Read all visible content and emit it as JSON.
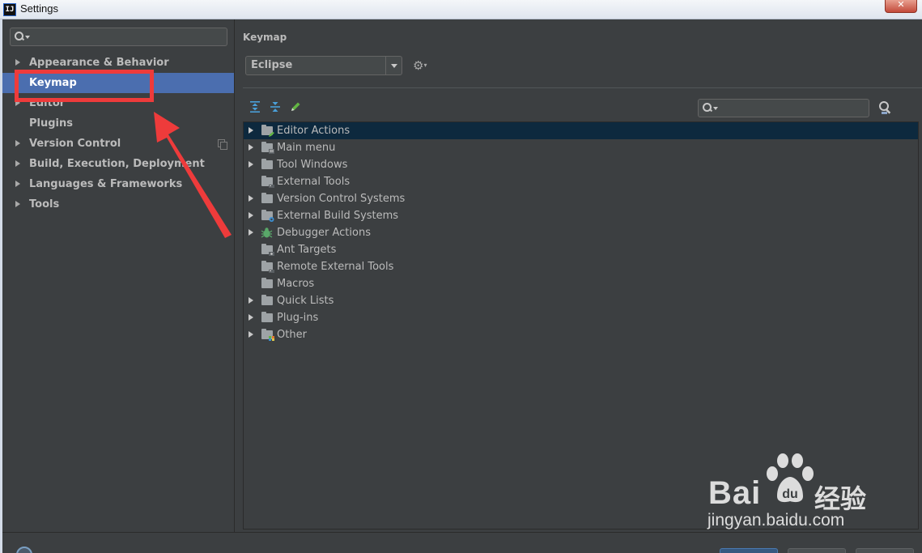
{
  "window": {
    "title": "Settings",
    "app_icon_text": "IJ"
  },
  "sidebar": {
    "search": {
      "value": ""
    },
    "items": [
      {
        "label": "Appearance & Behavior",
        "expandable": true
      },
      {
        "label": "Keymap",
        "expandable": false,
        "selected": true
      },
      {
        "label": "Editor",
        "expandable": true
      },
      {
        "label": "Plugins",
        "expandable": false
      },
      {
        "label": "Version Control",
        "expandable": true
      },
      {
        "label": "Build, Execution, Deployment",
        "expandable": true
      },
      {
        "label": "Languages & Frameworks",
        "expandable": true
      },
      {
        "label": "Tools",
        "expandable": true
      }
    ]
  },
  "content": {
    "title": "Keymap",
    "keymap_select": {
      "value": "Eclipse"
    },
    "tree": [
      {
        "label": "Editor Actions",
        "expandable": true,
        "icon": "editor-actions-icon",
        "selected": true
      },
      {
        "label": "Main menu",
        "expandable": true,
        "icon": "main-menu-icon"
      },
      {
        "label": "Tool Windows",
        "expandable": true,
        "icon": "folder-icon"
      },
      {
        "label": "External Tools",
        "expandable": false,
        "icon": "external-tools-icon"
      },
      {
        "label": "Version Control Systems",
        "expandable": true,
        "icon": "folder-icon"
      },
      {
        "label": "External Build Systems",
        "expandable": true,
        "icon": "build-systems-icon"
      },
      {
        "label": "Debugger Actions",
        "expandable": true,
        "icon": "bug-icon"
      },
      {
        "label": "Ant Targets",
        "expandable": false,
        "icon": "ant-targets-icon"
      },
      {
        "label": "Remote External Tools",
        "expandable": false,
        "icon": "remote-tools-icon"
      },
      {
        "label": "Macros",
        "expandable": false,
        "icon": "folder-icon"
      },
      {
        "label": "Quick Lists",
        "expandable": true,
        "icon": "folder-icon"
      },
      {
        "label": "Plug-ins",
        "expandable": true,
        "icon": "folder-icon"
      },
      {
        "label": "Other",
        "expandable": true,
        "icon": "other-icon"
      }
    ]
  },
  "watermark": {
    "brand": "Bai",
    "brand_cn": "经验",
    "url": "jingyan.baidu.com"
  },
  "colors": {
    "background": "#3c3f41",
    "selection": "#4b6eaf",
    "tree_selection": "#0d293e",
    "annotation": "#ee3b3b",
    "text": "#bbbbbb"
  }
}
